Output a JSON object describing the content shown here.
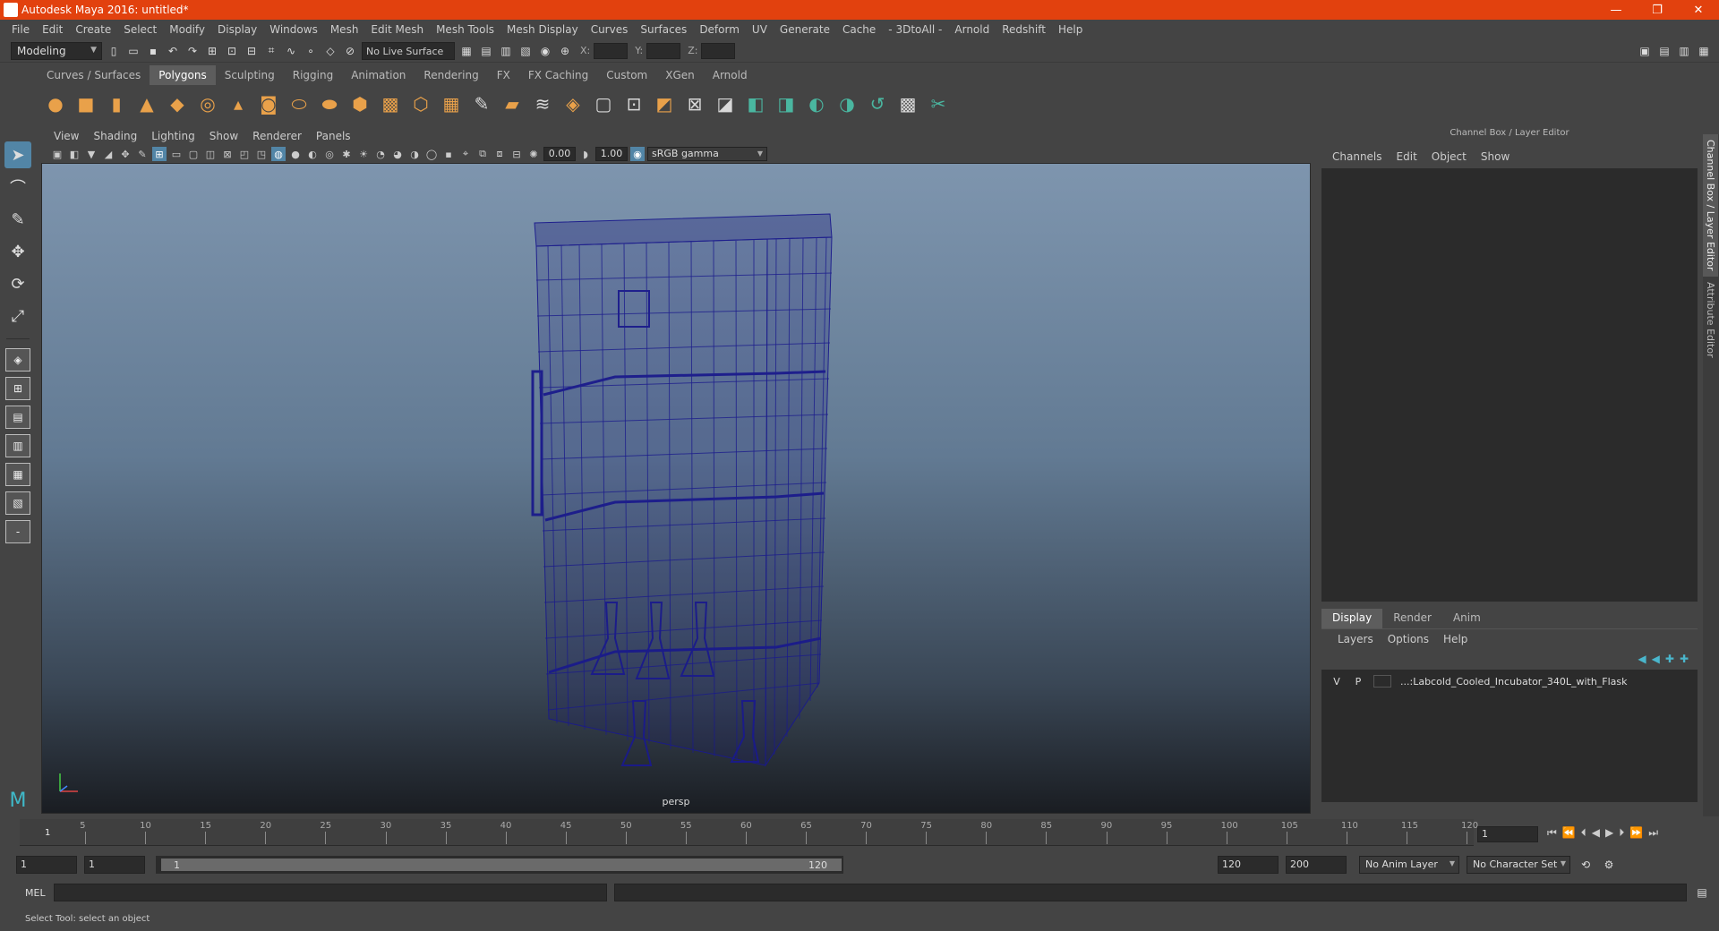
{
  "window": {
    "title": "Autodesk Maya 2016: untitled*",
    "controls": [
      "—",
      "❐",
      "✕"
    ]
  },
  "menubar": [
    "File",
    "Edit",
    "Create",
    "Select",
    "Modify",
    "Display",
    "Windows",
    "Mesh",
    "Edit Mesh",
    "Mesh Tools",
    "Mesh Display",
    "Curves",
    "Surfaces",
    "Deform",
    "UV",
    "Generate",
    "Cache",
    "- 3DtoAll -",
    "Arnold",
    "Redshift",
    "Help"
  ],
  "statusline": {
    "mode": "Modeling",
    "live_surface": "No Live Surface",
    "x_label": "X:",
    "y_label": "Y:",
    "z_label": "Z:"
  },
  "shelf": {
    "tabs": [
      "Curves / Surfaces",
      "Polygons",
      "Sculpting",
      "Rigging",
      "Animation",
      "Rendering",
      "FX",
      "FX Caching",
      "Custom",
      "XGen",
      "Arnold"
    ],
    "active_tab": "Polygons"
  },
  "panel": {
    "menus": [
      "View",
      "Shading",
      "Lighting",
      "Show",
      "Renderer",
      "Panels"
    ],
    "exposure": "0.00",
    "gamma_value": "1.00",
    "color_space": "sRGB gamma",
    "camera": "persp"
  },
  "channel_box": {
    "title": "Channel Box / Layer Editor",
    "menus": [
      "Channels",
      "Edit",
      "Object",
      "Show"
    ]
  },
  "layer_editor": {
    "tabs": [
      "Display",
      "Render",
      "Anim"
    ],
    "active_tab": "Display",
    "menus": [
      "Layers",
      "Options",
      "Help"
    ],
    "layers": [
      {
        "v": "V",
        "p": "P",
        "name": "...:Labcold_Cooled_Incubator_340L_with_Flask"
      }
    ]
  },
  "side_tabs": [
    "Channel Box / Layer Editor",
    "Attribute Editor"
  ],
  "timeslider": {
    "current_frame": "1",
    "ticks": [
      "5",
      "10",
      "15",
      "20",
      "25",
      "30",
      "35",
      "40",
      "45",
      "50",
      "55",
      "60",
      "65",
      "70",
      "75",
      "80",
      "85",
      "90",
      "95",
      "100",
      "105",
      "110",
      "115",
      "120"
    ],
    "frame_field": "1"
  },
  "range": {
    "start": "1",
    "playback_start": "1",
    "bar_start": "1",
    "bar_end": "120",
    "playback_end": "120",
    "end": "200",
    "anim_layer": "No Anim Layer",
    "character_set": "No Character Set"
  },
  "cmdline": {
    "label": "MEL"
  },
  "helpline": {
    "text": "Select Tool: select an object"
  },
  "colors": {
    "titlebar": "#e2410e",
    "wireframe": "#1a1a8c",
    "active_tool": "#5285a6"
  }
}
